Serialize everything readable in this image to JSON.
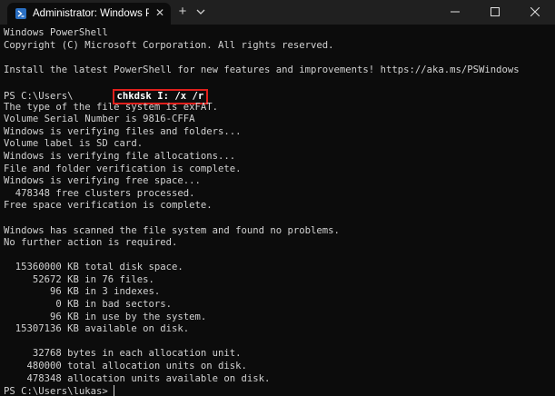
{
  "titlebar": {
    "tab_title": "Administrator: Windows PowerShell",
    "tab_close": "✕",
    "new_tab": "+",
    "icons": {
      "tab": "powershell-icon",
      "close": "close-icon",
      "new": "plus-icon",
      "dropdown": "chevron-down-icon",
      "minimize": "minimize-icon",
      "maximize": "maximize-icon",
      "window_close": "close-icon"
    }
  },
  "terminal": {
    "header_lines": [
      "Windows PowerShell",
      "Copyright (C) Microsoft Corporation. All rights reserved.",
      "",
      "Install the latest PowerShell for new features and improvements! https://aka.ms/PSWindows",
      ""
    ],
    "prompt_prefix": "PS C:\\Users\\",
    "command": "chkdsk I: /x /r",
    "output_lines": [
      "The type of the file system is exFAT.",
      "Volume Serial Number is 9816-CFFA",
      "Windows is verifying files and folders...",
      "Volume label is SD card.",
      "Windows is verifying file allocations...",
      "File and folder verification is complete.",
      "Windows is verifying free space...",
      "  478348 free clusters processed.",
      "Free space verification is complete.",
      "",
      "Windows has scanned the file system and found no problems.",
      "No further action is required.",
      "",
      "  15360000 KB total disk space.",
      "     52672 KB in 76 files.",
      "        96 KB in 3 indexes.",
      "         0 KB in bad sectors.",
      "        96 KB in use by the system.",
      "  15307136 KB available on disk.",
      "",
      "     32768 bytes in each allocation unit.",
      "    480000 total allocation units on disk.",
      "    478348 allocation units available on disk."
    ],
    "final_prompt": "PS C:\\Users\\lukas> "
  },
  "colors": {
    "background": "#0c0c0c",
    "titlebar": "#202020",
    "text": "#d2d2d2",
    "highlight_border": "#e0201c"
  }
}
